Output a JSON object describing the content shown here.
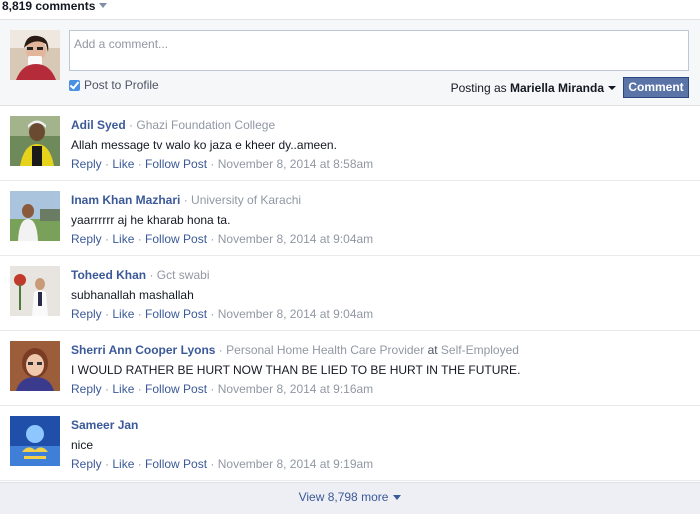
{
  "header": {
    "comment_count": "8,819 comments"
  },
  "composer": {
    "placeholder": "Add a comment...",
    "post_to_profile_label": "Post to Profile",
    "post_to_profile_checked": true,
    "posting_as_prefix": "Posting as ",
    "posting_as_name": "Mariella Miranda",
    "comment_button": "Comment"
  },
  "actions": {
    "reply": "Reply",
    "like": "Like",
    "follow": "Follow Post",
    "dot": " · "
  },
  "comments": [
    {
      "author": "Adil Syed",
      "affiliation": "Ghazi Foundation College",
      "text": "Allah message tv walo ko jaza e kheer dy..ameen.",
      "time": "November 8, 2014 at 8:58am"
    },
    {
      "author": "Inam Khan Mazhari",
      "affiliation": "University of Karachi",
      "text": "yaarrrrrr aj he kharab hona ta.",
      "time": "November 8, 2014 at 9:04am"
    },
    {
      "author": "Toheed Khan",
      "affiliation": "Gct swabi",
      "text": "subhanallah mashallah",
      "time": "November 8, 2014 at 9:04am"
    },
    {
      "author": "Sherri Ann Cooper Lyons",
      "affiliation": "Personal Home Health Care Provider",
      "affiliation_at": " at ",
      "affiliation_org": "Self-Employed",
      "text": "I WOULD RATHER BE HURT NOW THAN BE LIED TO BE HURT IN THE FUTURE.",
      "time": "November 8, 2014 at 9:16am"
    },
    {
      "author": "Sameer Jan",
      "affiliation": "",
      "text": "nice",
      "time": "November 8, 2014 at 9:19am"
    }
  ],
  "footer": {
    "view_more": "View 8,798 more"
  },
  "colors": {
    "link": "#3b5998",
    "muted": "#9197a3",
    "button": "#5b74a8",
    "panel": "#f6f7f8"
  }
}
